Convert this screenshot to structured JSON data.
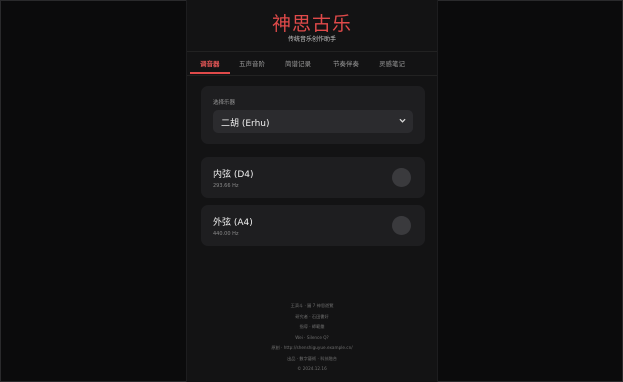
{
  "app": {
    "title": "神思古乐",
    "subtitle": "传统音乐创作助手"
  },
  "tabs": [
    {
      "label": "调音器",
      "active": true
    },
    {
      "label": "五声音阶",
      "active": false
    },
    {
      "label": "简谱记录",
      "active": false
    },
    {
      "label": "节奏伴奏",
      "active": false
    },
    {
      "label": "灵感笔记",
      "active": false
    }
  ],
  "instrument_select": {
    "label": "选择乐器",
    "value": "二胡 (Erhu)"
  },
  "strings": [
    {
      "name": "内弦 (D4)",
      "frequency": "293.66 Hz"
    },
    {
      "name": "外弦 (A4)",
      "frequency": "440.00 Hz"
    }
  ],
  "footer": {
    "lines": [
      "王濟斗 · 圖 7 神思遊覽",
      "研究者 · 石田書好",
      "指導 · 師範彙",
      "Wei · Silence Q?",
      "原創 · http://shenshiguyue.example.cn/",
      "出品 · 數字藝術 · 科技融合",
      "© 2024.12.16"
    ]
  },
  "colors": {
    "accent": "#e04a4a",
    "background": "#0b0b0c",
    "panel": "#131314",
    "card": "#1e1e20"
  }
}
